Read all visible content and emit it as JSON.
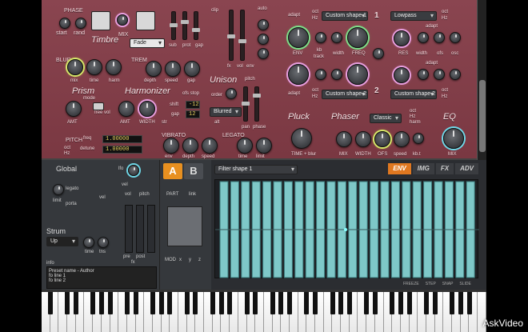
{
  "watermark": {
    "brand": "AskVideo",
    "suffix": "®"
  },
  "top": {
    "phase": "PHASE",
    "start": "start",
    "rand": "rand",
    "mix": "MIX",
    "timbre": "Timbre",
    "fade": "Fade",
    "sub": "sub",
    "prot": "prot",
    "gap": "gap",
    "clip": "clip",
    "fx": "fx",
    "vol": "vol",
    "env": "env",
    "auto": "auto",
    "blur": "BLUR",
    "blur_mix": "mix",
    "blur_time": "time",
    "blur_harm": "harm",
    "trem": "TREM",
    "depth": "depth",
    "speed": "speed",
    "trem_gap": "gap",
    "prism": "Prism",
    "mode": "mode",
    "freevol": "free vol",
    "amt": "AMT",
    "harmonizer": "Harmonizer",
    "harm_amt": "AMT",
    "width": "WIDTH",
    "str": "str",
    "ofs_stop": "ofs stop",
    "shift": "shift",
    "shift_val": "-12",
    "gap2": "gap",
    "gap_val": "12",
    "unison": "Unison",
    "pitch": "pitch",
    "order": "order",
    "blurred": "Blurred",
    "alt": "alt",
    "pan": "pan",
    "phase_lbl": "phase",
    "pitch_box": "PITCH",
    "freq": "freq",
    "detune": "detune",
    "oct": "oct",
    "hz": "Hz",
    "freq_val": "1.00000",
    "detune_val": "1.00000",
    "vibrato": "VIBRATO",
    "vib_env": "env",
    "vib_depth": "depth",
    "vib_speed": "speed",
    "legato": "LEGATO",
    "leg_time": "time",
    "leg_limit": "limit",
    "adapt": "adapt",
    "shape1": "Custom shape 1",
    "lowpass": "Lowpass",
    "env_lbl": "ENV",
    "kb": "kb",
    "track": "track",
    "fwidth": "width",
    "freq_lbl": "FREQ",
    "res": "RES",
    "f_width": "width",
    "ofs": "ofs",
    "osc": "osc",
    "shape2": "Custom shape 2",
    "shape2b": "Custom shape 2",
    "pluck": "Pluck",
    "phaser": "Phaser",
    "classic": "Classic",
    "eq": "EQ",
    "time_blur": "TIME + blur",
    "ph_mix": "MIX",
    "ph_width": "WIDTH",
    "ph_ofs": "OFS",
    "ph_speed": "speed",
    "kbt": "kb.t",
    "eq_mix": "MIX",
    "harm_lbl": "harm",
    "harm2": "harm",
    "num1": "1",
    "num2": "2",
    "minus": "−"
  },
  "bottom": {
    "global": "Global",
    "lfo": "lfo",
    "legato": "legato",
    "vel": "vel",
    "porta": "porta",
    "limit": "limit",
    "strum": "Strum",
    "up": "Up",
    "time": "time",
    "tns": "tns",
    "info": "info",
    "info_lines": [
      "Preset name - Author",
      "fo line 1",
      "fo line 2"
    ],
    "tabA": "A",
    "tabB": "B",
    "filter_shape": "Filter shape 1",
    "vel2": "vel",
    "vol": "vol",
    "pitch": "pitch",
    "part": "PART",
    "link": "link",
    "pre": "pre",
    "post": "post",
    "fx": "fx",
    "mod": "MOD",
    "x": "x",
    "y": "y",
    "z": "z",
    "env_tab": "ENV",
    "img_tab": "IMG",
    "fx_tab": "FX",
    "adv_tab": "ADV",
    "freeze": "FREEZE",
    "step": "STEP",
    "snap": "SNAP",
    "slide": "SLIDE"
  }
}
